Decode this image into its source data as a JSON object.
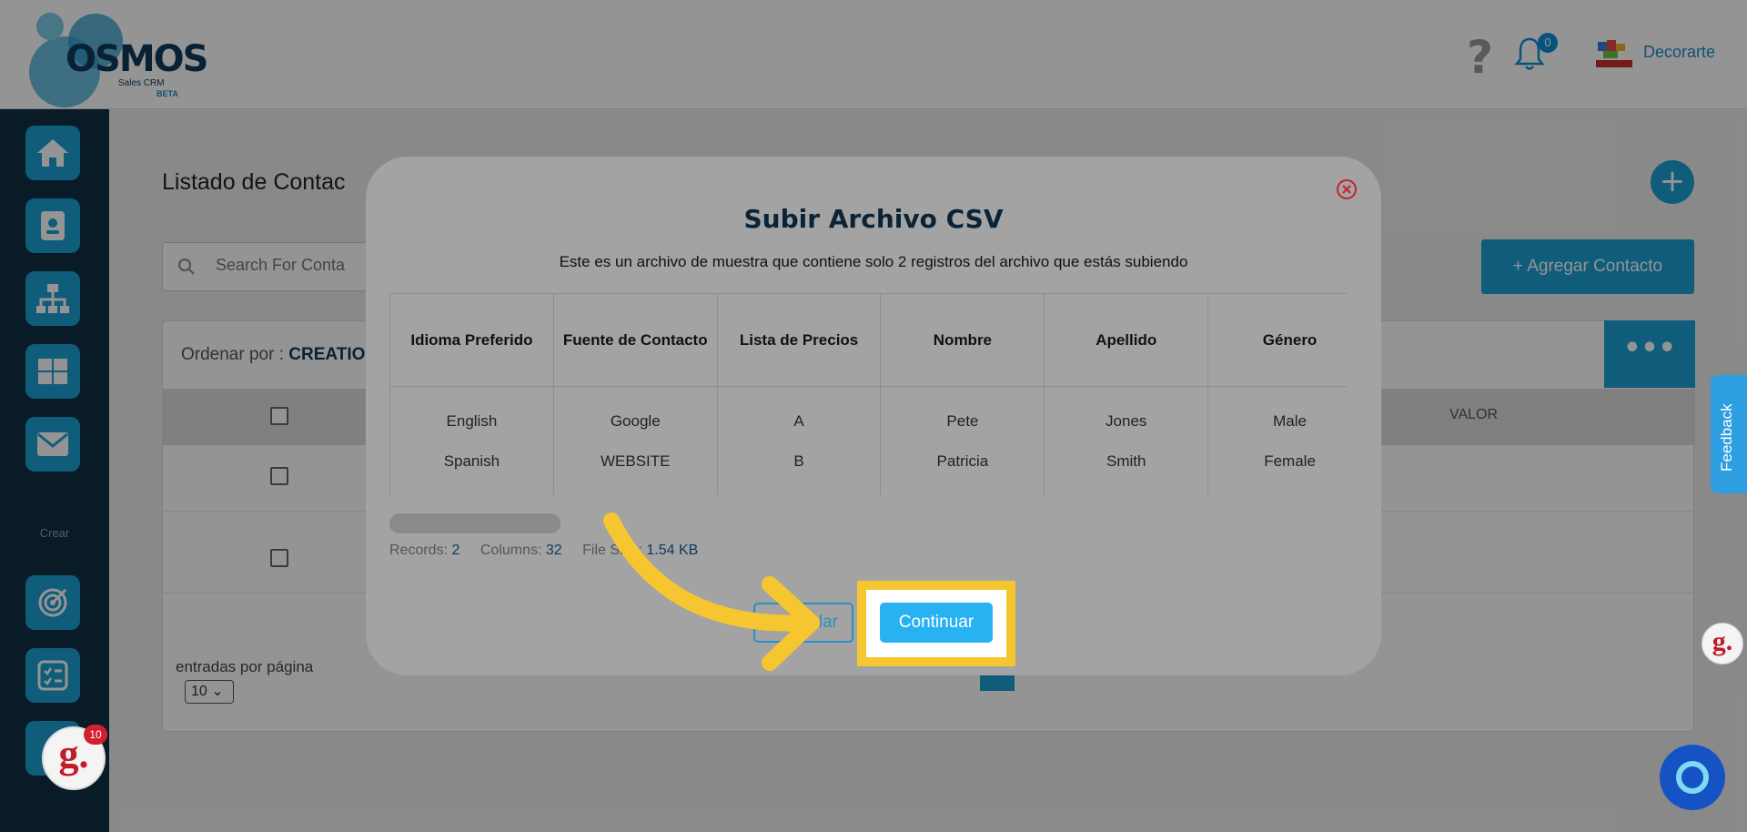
{
  "header": {
    "logo_text": "OSMOS",
    "logo_sub": "Sales CRM",
    "logo_beta": "BETA",
    "notification_count": "0",
    "account_name": "Decorarte"
  },
  "sidebar": {
    "items": [
      {
        "icon": "home-icon"
      },
      {
        "icon": "contact-card-icon"
      },
      {
        "icon": "org-chart-icon"
      },
      {
        "icon": "grid-icon"
      },
      {
        "icon": "mail-icon"
      }
    ],
    "create_label": "Crear",
    "create_items": [
      {
        "icon": "target-icon"
      },
      {
        "icon": "checklist-icon"
      }
    ]
  },
  "page": {
    "title": "Listado de Contac",
    "search_placeholder": "Search For Conta",
    "add_contact_label": "+ Agregar Contacto",
    "sort_label": "Ordenar por : ",
    "sort_value": "CREATIO",
    "valor_header": "VALOR",
    "entries_label": "entradas por página",
    "entries_value": "10"
  },
  "modal": {
    "title": "Subir Archivo CSV",
    "description": "Este es un archivo de muestra que contiene solo 2 registros del archivo que estás subiendo",
    "columns": [
      "Idioma Preferido",
      "Fuente de Contacto",
      "Lista de Precios",
      "Nombre",
      "Apellido",
      "Género"
    ],
    "rows": [
      [
        "English",
        "Google",
        "A",
        "Pete",
        "Jones",
        "Male"
      ],
      [
        "Spanish",
        "WEBSITE",
        "B",
        "Patricia",
        "Smith",
        "Female"
      ]
    ],
    "records_label": "Records:",
    "records_value": "2",
    "columns_label": "Columns:",
    "columns_value": "32",
    "filesize_label": "File Size:",
    "filesize_value": "1.54 KB",
    "cancel_label": "Cancelar",
    "continue_label": "Continuar"
  },
  "widgets": {
    "feedback_label": "Feedback",
    "g_label": "g.",
    "g_badge": "10"
  },
  "colors": {
    "accent": "#1a9fd4",
    "sidebar": "#0e2f44",
    "highlight": "#f6c630",
    "continue": "#29b2f2"
  }
}
